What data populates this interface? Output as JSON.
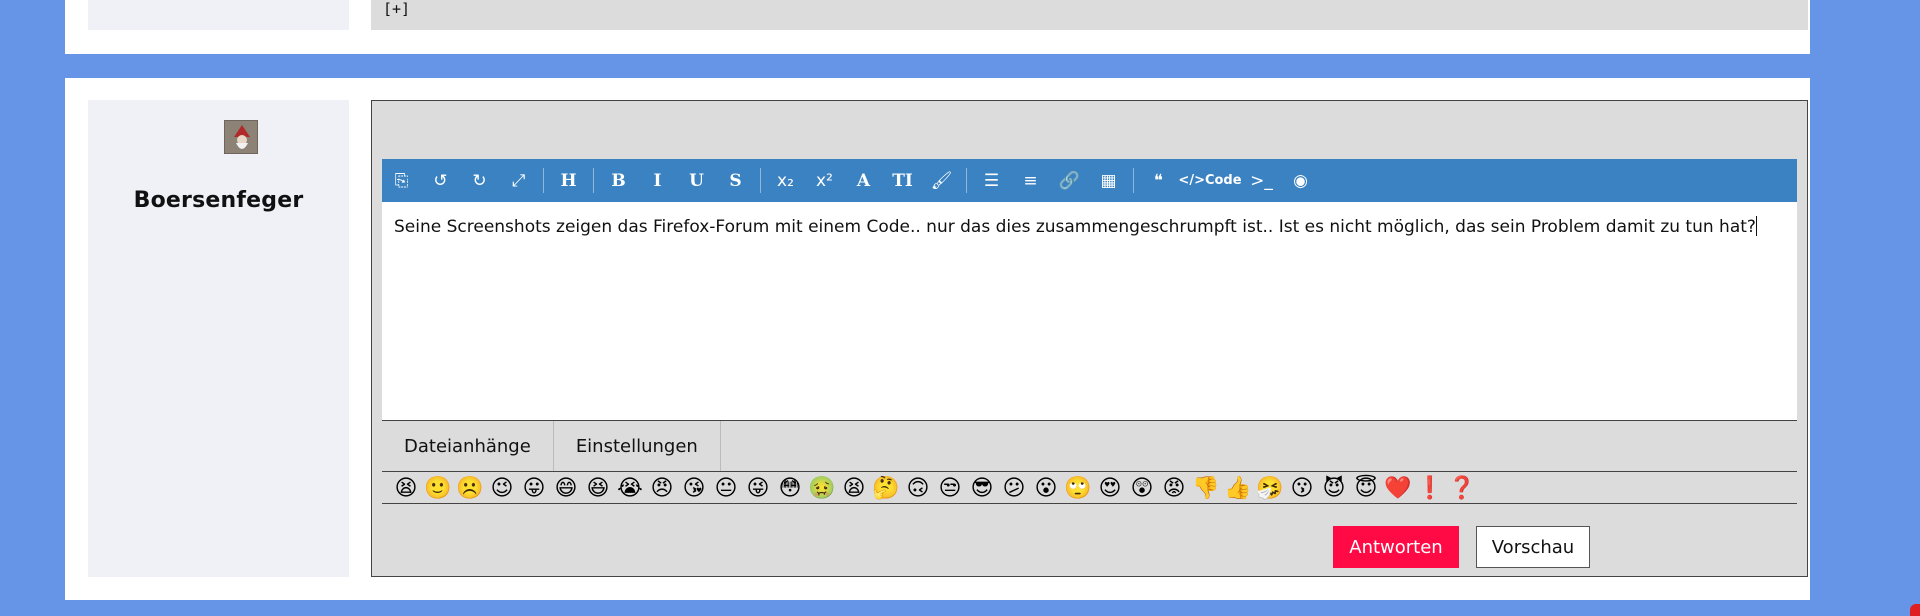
{
  "previous_post": {
    "expand_label": "[+]"
  },
  "author": {
    "username": "Boersenfeger"
  },
  "editor": {
    "toolbar": [
      {
        "name": "source-icon",
        "glyph": "⎘"
      },
      {
        "name": "undo-icon",
        "glyph": "↺"
      },
      {
        "name": "redo-icon",
        "glyph": "↻"
      },
      {
        "name": "maximize-icon",
        "glyph": "⤢"
      },
      {
        "sep": true
      },
      {
        "name": "heading-icon",
        "glyph": "H",
        "serif": true
      },
      {
        "sep": true
      },
      {
        "name": "bold-icon",
        "glyph": "B",
        "serif": true
      },
      {
        "name": "italic-icon",
        "glyph": "I",
        "serif": true
      },
      {
        "name": "underline-icon",
        "glyph": "U",
        "serif": true
      },
      {
        "name": "strikethrough-icon",
        "glyph": "S",
        "serif": true
      },
      {
        "sep": true
      },
      {
        "name": "subscript-icon",
        "glyph": "x₂"
      },
      {
        "name": "superscript-icon",
        "glyph": "x²"
      },
      {
        "name": "font-icon",
        "glyph": "A",
        "serif": true
      },
      {
        "name": "font-size-icon",
        "glyph": "TI",
        "serif": true
      },
      {
        "name": "color-brush-icon",
        "glyph": "🖌"
      },
      {
        "sep": true
      },
      {
        "name": "list-icon",
        "glyph": "☰"
      },
      {
        "name": "align-icon",
        "glyph": "≡"
      },
      {
        "name": "link-icon",
        "glyph": "🔗"
      },
      {
        "name": "table-icon",
        "glyph": "▦"
      },
      {
        "sep": true
      },
      {
        "name": "quote-icon",
        "glyph": "❝"
      },
      {
        "name": "code-icon",
        "glyph": "</>Code",
        "wide": true
      },
      {
        "name": "inline-code-icon",
        "glyph": ">_"
      },
      {
        "name": "spoiler-icon",
        "glyph": "◉"
      }
    ],
    "text": "Seine Screenshots zeigen das Firefox-Forum mit einem Code.. nur das dies zusammengeschrumpft ist.. Ist es nicht möglich, das sein Problem damit zu tun hat?",
    "tabs": [
      "Dateianhänge",
      "Einstellungen"
    ],
    "emojis": [
      "😫",
      "🙂",
      "☹️",
      "😉",
      "😛",
      "😄",
      "😆",
      "😭",
      "😠",
      "😘",
      "😐",
      "😜",
      "😳",
      "🤢",
      "😫",
      "🤔",
      "🙃",
      "😒",
      "😎",
      "😕",
      "😮",
      "🙄",
      "😍",
      "😲",
      "😡",
      "👎",
      "👍",
      "🤧",
      "😗",
      "😈",
      "😇",
      "❤️",
      "❗",
      "❓"
    ]
  },
  "actions": {
    "submit_label": "Antworten",
    "preview_label": "Vorschau"
  }
}
